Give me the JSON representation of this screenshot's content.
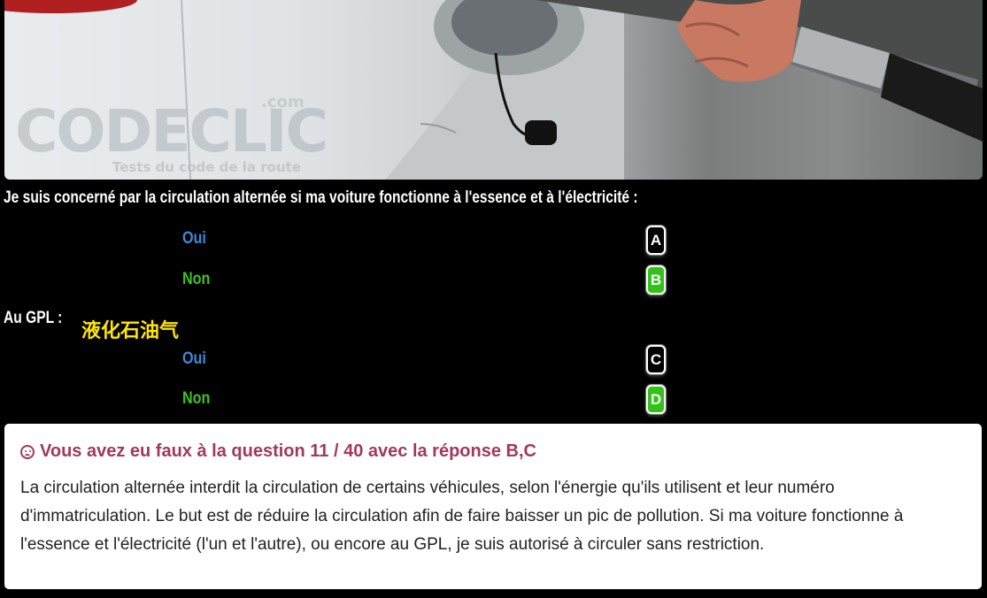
{
  "photo": {
    "watermark": "CODECLIC",
    "watermark_domain": ".com",
    "watermark_tagline": "Tests du code de la route"
  },
  "question": {
    "text": "Je suis concerné par la circulation alternée si ma voiture fonctionne à l'essence et à l'électricité :",
    "answers": [
      {
        "label": "Oui",
        "letter": "A",
        "selected": false
      },
      {
        "label": "Non",
        "letter": "B",
        "selected": true
      }
    ]
  },
  "sub_question": {
    "text": "Au GPL :",
    "translation": "液化石油气",
    "answers": [
      {
        "label": "Oui",
        "letter": "C",
        "selected": false
      },
      {
        "label": "Non",
        "letter": "D",
        "selected": true
      }
    ]
  },
  "feedback": {
    "icon": "frown-icon",
    "title": "Vous avez eu faux à la question 11 / 40 avec la réponse B,C",
    "explanation": "La circulation alternée interdit la circulation de certains véhicules, selon l'énergie qu'ils utilisent et leur numéro d'immatriculation. Le but est de réduire la circulation afin de faire baisser un pic de pollution. Si ma voiture fonctionne à l'essence et l'électricité (l'un et l'autre), ou encore au GPL, je suis autorisé à circuler sans restriction."
  },
  "colors": {
    "oui": "#3d87d8",
    "non": "#3cc21e",
    "selected_box": "#33c21a",
    "title": "#a3375d"
  }
}
